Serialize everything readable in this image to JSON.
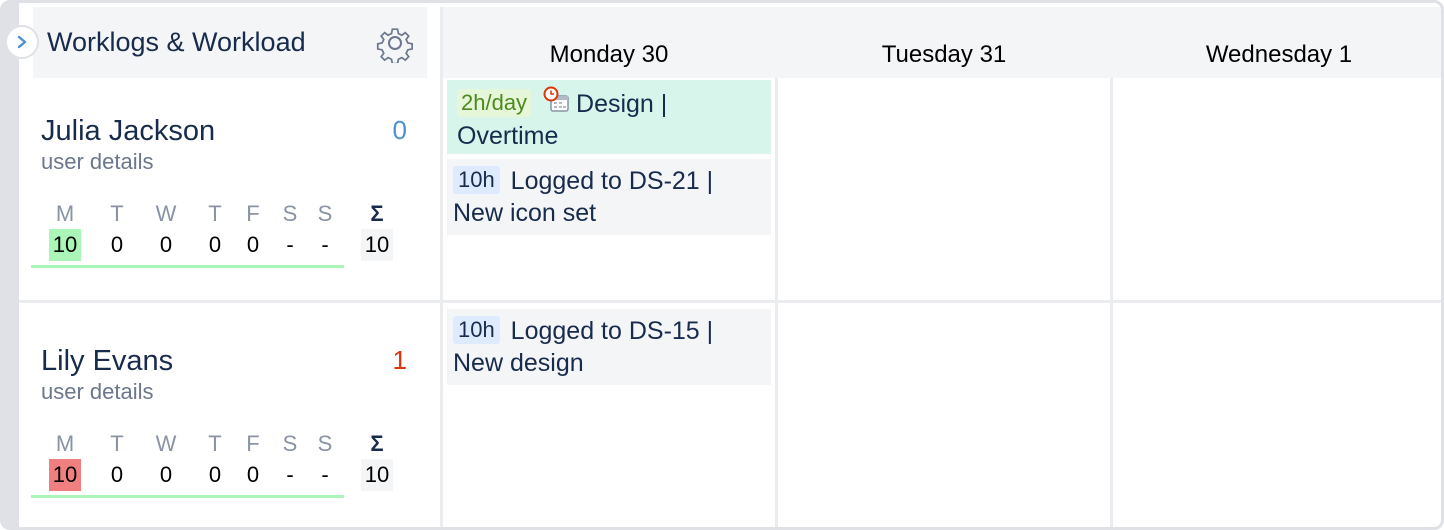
{
  "header": {
    "title": "Worklogs & Workload",
    "expand_icon": "chevron-right-icon",
    "settings_icon": "gear-icon"
  },
  "days": [
    {
      "label": "Monday 30"
    },
    {
      "label": "Tuesday 31"
    },
    {
      "label": "Wednesday 1"
    }
  ],
  "week_letters": [
    "M",
    "T",
    "W",
    "T",
    "F",
    "S",
    "S"
  ],
  "sigma": "Σ",
  "users": [
    {
      "name": "Julia Jackson",
      "details": "user details",
      "count": "0",
      "count_color": "#4a90d9",
      "week_values": [
        "10",
        "0",
        "0",
        "0",
        "0",
        "-",
        "-"
      ],
      "first_day_highlight": "#abf5b8",
      "total": "10"
    },
    {
      "name": "Lily Evans",
      "details": "user details",
      "count": "1",
      "count_color": "#de350b",
      "week_values": [
        "10",
        "0",
        "0",
        "0",
        "0",
        "-",
        "-"
      ],
      "first_day_highlight": "#f08080",
      "total": "10"
    }
  ],
  "worklogs": {
    "julia_overtime": {
      "rate": "2h/day",
      "icon": "calendar-clock-icon",
      "text": "Design | Overtime"
    },
    "julia_log": {
      "hours": "10h",
      "text": "Logged to DS-21 | New icon set"
    },
    "lily_log": {
      "hours": "10h",
      "text": "Logged to DS-15 | New design"
    }
  }
}
